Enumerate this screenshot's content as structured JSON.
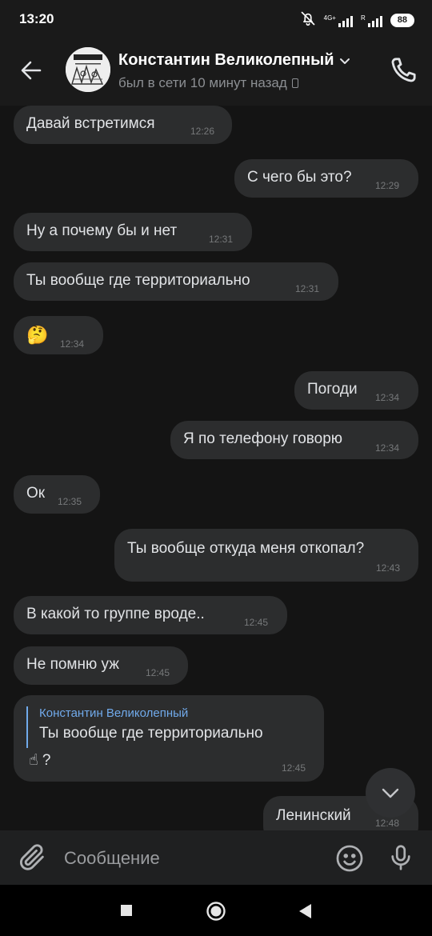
{
  "status_bar": {
    "time": "13:20",
    "network_1": "4G+",
    "network_2": "R",
    "battery": "88",
    "icons": [
      "bell-off-icon",
      "signal-icon",
      "signal-icon",
      "battery-icon"
    ]
  },
  "header": {
    "contact_name": "Константин Великолепный",
    "last_seen": "был в сети 10 минут назад",
    "icons": [
      "back-arrow-icon",
      "chevron-down-icon",
      "mobile-device-icon",
      "phone-call-icon"
    ]
  },
  "messages": [
    {
      "dir": "in",
      "text": "Давай встретимся",
      "time": "12:26"
    },
    {
      "dir": "out",
      "text": "С чего бы это?",
      "time": "12:29"
    },
    {
      "dir": "in",
      "text": "Ну а почему бы и нет",
      "time": "12:31"
    },
    {
      "dir": "in",
      "text": "Ты вообще где территориально",
      "time": "12:31"
    },
    {
      "dir": "in",
      "text": "🤔",
      "time": "12:34"
    },
    {
      "dir": "out",
      "text": "Погоди",
      "time": "12:34"
    },
    {
      "dir": "out",
      "text": "Я по телефону говорю",
      "time": "12:34"
    },
    {
      "dir": "in",
      "text": "Ок",
      "time": "12:35"
    },
    {
      "dir": "out",
      "text": "Ты вообще откуда меня откопал?",
      "time": "12:43"
    },
    {
      "dir": "in",
      "text": "В какой то группе вроде..",
      "time": "12:45"
    },
    {
      "dir": "in",
      "text": "Не помню уж",
      "time": "12:45"
    },
    {
      "dir": "in",
      "reply_author": "Константин Великолепный",
      "reply_text": "Ты вообще где территориально",
      "text": "☝ ?",
      "time": "12:45"
    },
    {
      "dir": "out",
      "text": "Ленинский",
      "time": "12:48"
    }
  ],
  "composer": {
    "placeholder": "Сообщение",
    "icons": [
      "paperclip-icon",
      "emoji-icon",
      "microphone-icon"
    ]
  },
  "colors": {
    "background": "#141414",
    "bar": "#1a1a1a",
    "bubble": "#2c2d2e",
    "text": "#e1e3e6",
    "time_text": "#76787a",
    "accent": "#71aaeb"
  }
}
